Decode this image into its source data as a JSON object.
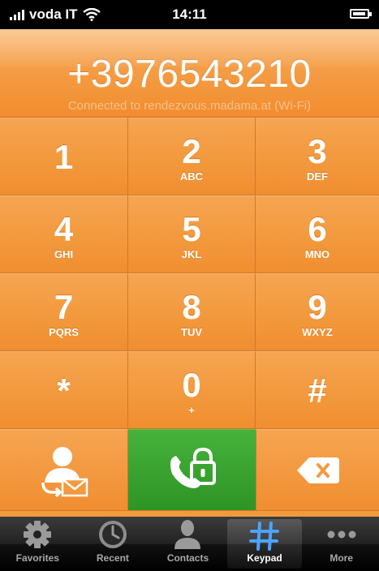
{
  "status": {
    "carrier": "voda IT",
    "time": "14:11"
  },
  "display": {
    "number": "+3976543210",
    "connection": "Connected to rendezvous.madama.at (Wi-Fi)"
  },
  "keys": [
    {
      "digit": "1",
      "letters": ""
    },
    {
      "digit": "2",
      "letters": "ABC"
    },
    {
      "digit": "3",
      "letters": "DEF"
    },
    {
      "digit": "4",
      "letters": "GHI"
    },
    {
      "digit": "5",
      "letters": "JKL"
    },
    {
      "digit": "6",
      "letters": "MNO"
    },
    {
      "digit": "7",
      "letters": "PQRS"
    },
    {
      "digit": "8",
      "letters": "TUV"
    },
    {
      "digit": "9",
      "letters": "WXYZ"
    },
    {
      "digit": "*",
      "letters": ""
    },
    {
      "digit": "0",
      "letters": "+"
    },
    {
      "digit": "#",
      "letters": ""
    }
  ],
  "actions": {
    "add_contact_icon": "add-contact-icon",
    "call_icon": "secure-call-icon",
    "delete_icon": "backspace-icon"
  },
  "tabs": [
    {
      "label": "Favorites",
      "icon": "gear-icon"
    },
    {
      "label": "Recent",
      "icon": "clock-icon"
    },
    {
      "label": "Contacts",
      "icon": "person-icon"
    },
    {
      "label": "Keypad",
      "icon": "keypad-icon",
      "active": true
    },
    {
      "label": "More",
      "icon": "more-icon"
    }
  ],
  "colors": {
    "accent": "#f39a3e",
    "call": "#3aa52f",
    "keypad_tab_icon": "#4da3ff"
  }
}
